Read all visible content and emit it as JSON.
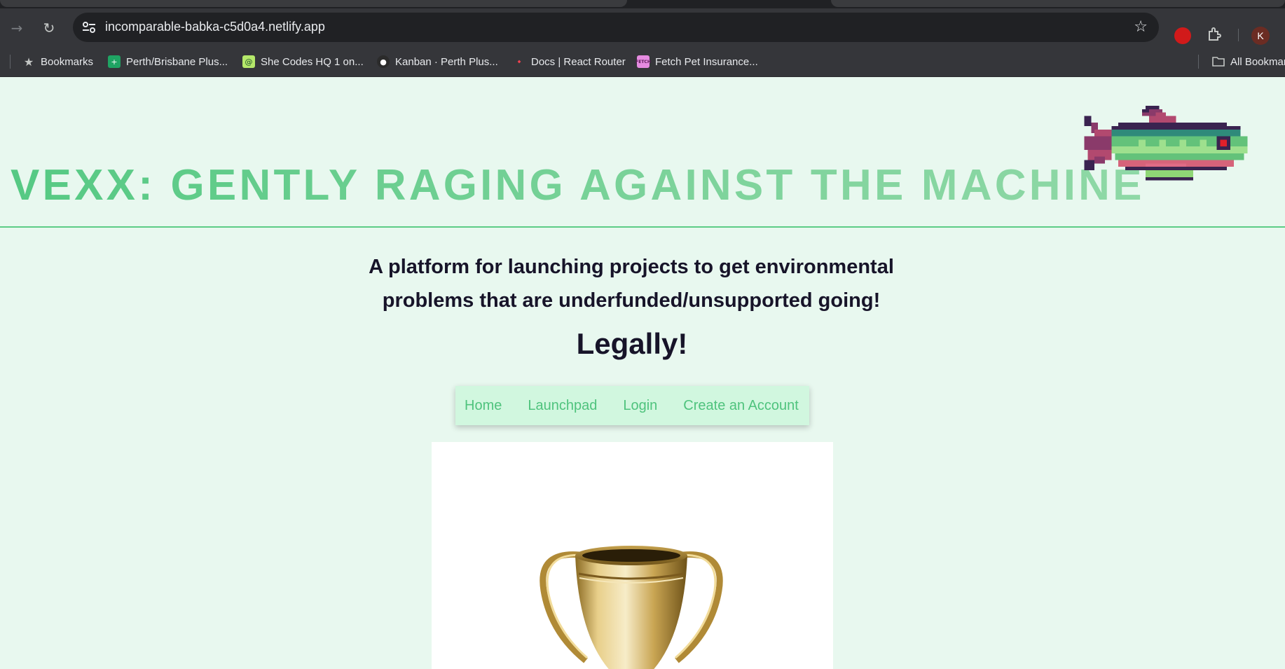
{
  "browser": {
    "url": "incomparable-babka-c5d0a4.netlify.app",
    "profile_initial": "K",
    "icons": [
      "forward-arrow-icon",
      "reload-icon",
      "site-settings-icon",
      "star-icon",
      "extension-icon",
      "puzzle-icon"
    ]
  },
  "bookmarks": [
    {
      "label": "Bookmarks",
      "icon": "star-icon"
    },
    {
      "label": "Perth/Brisbane Plus...",
      "icon": "sheets-icon"
    },
    {
      "label": "She Codes HQ 1 on...",
      "icon": "spiral-icon"
    },
    {
      "label": "Kanban · Perth Plus...",
      "icon": "github-icon"
    },
    {
      "label": "Docs | React Router",
      "icon": "react-router-icon"
    },
    {
      "label": "Fetch Pet Insurance...",
      "icon": "fetch-icon"
    },
    {
      "label": "All Bookmarks",
      "icon": "folder-icon"
    }
  ],
  "header": {
    "title": "VEXX: GENTLY RAGING AGAINST THE MACHINE"
  },
  "intro": {
    "tagline": "A platform for launching projects to get environmental problems that are underfunded/unsupported going!",
    "emphasis": "Legally!"
  },
  "nav": {
    "items": [
      {
        "label": "Home"
      },
      {
        "label": "Launchpad"
      },
      {
        "label": "Login"
      },
      {
        "label": "Create an Account"
      }
    ]
  },
  "colors": {
    "page_bg": "#e8f8ef",
    "accent_green": "#55c983",
    "nav_bg": "#d1f7df",
    "text_dark": "#171429"
  }
}
